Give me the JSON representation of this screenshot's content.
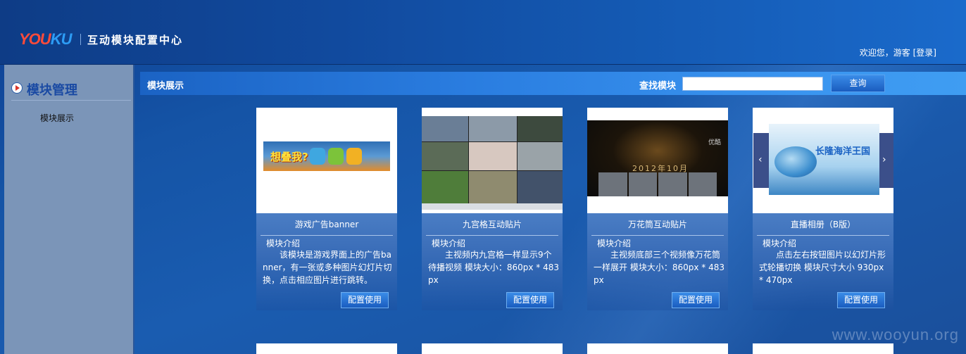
{
  "header": {
    "logo_part1": "YOU",
    "logo_part2": "KU",
    "site_title": "互动模块配置中心",
    "welcome_text": "欢迎您，游客",
    "login_link": "[登录]"
  },
  "sidebar": {
    "title": "模块管理",
    "items": [
      {
        "label": "模块展示"
      }
    ]
  },
  "main": {
    "bar_title": "模块展示",
    "search": {
      "label": "查找模块",
      "value": "",
      "placeholder": "",
      "button_label": "查询"
    }
  },
  "cards": [
    {
      "name": "游戏广告banner",
      "intro_label": "模块介绍",
      "description": "该模块是游戏界面上的广告banner，有一张或多种图片幻灯片切换，点击相应图片进行跳转。",
      "button_label": "配置使用",
      "thumb_text": "想叠我?"
    },
    {
      "name": "九宫格互动贴片",
      "intro_label": "模块介绍",
      "description": "主视频内九宫格一样显示9个待播视频 模块大小：860px * 483px",
      "button_label": "配置使用"
    },
    {
      "name": "万花筒互动贴片",
      "intro_label": "模块介绍",
      "description": "主视频底部三个视频像万花筒一样展开 模块大小：860px * 483px",
      "button_label": "配置使用",
      "thumb_text": "2012年10月",
      "thumb_logo": "优酷"
    },
    {
      "name": "直播相册（B版）",
      "intro_label": "模块介绍",
      "description": "点击左右按钮图片以幻灯片形式轮播切换 模块尺寸大小 930px * 470px",
      "button_label": "配置使用",
      "thumb_text": "长隆海洋王国"
    }
  ],
  "watermark": "www.wooyun.org",
  "colors": {
    "header_bg": "#114a9e",
    "sidebar_bg": "#7b95b8",
    "accent_bar": "#2a7de0",
    "button_bg": "#1a5cbf"
  }
}
